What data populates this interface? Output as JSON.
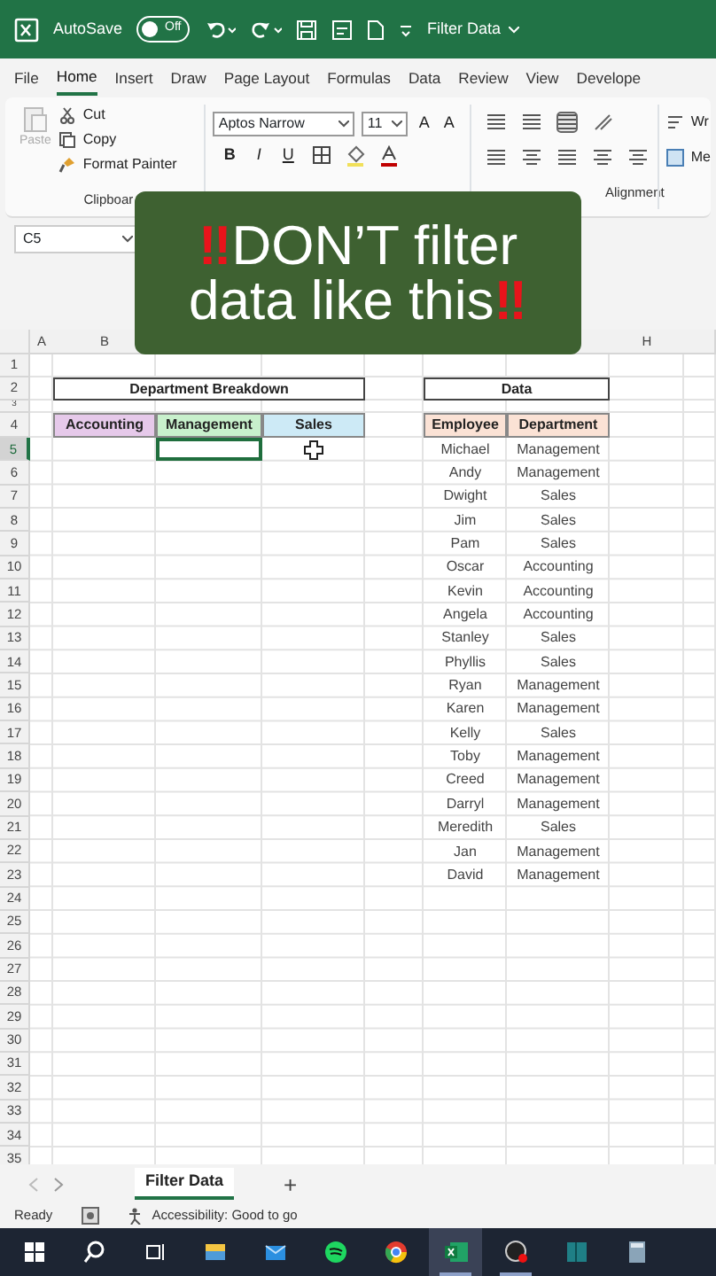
{
  "title_bar": {
    "autosave_label": "AutoSave",
    "autosave_state": "Off",
    "autosave_on": false,
    "file_title": "Filter Data"
  },
  "menu_tabs": [
    {
      "label": "File",
      "selected": false
    },
    {
      "label": "Home",
      "selected": true
    },
    {
      "label": "Insert",
      "selected": false
    },
    {
      "label": "Draw",
      "selected": false
    },
    {
      "label": "Page Layout",
      "selected": false
    },
    {
      "label": "Formulas",
      "selected": false
    },
    {
      "label": "Data",
      "selected": false
    },
    {
      "label": "Review",
      "selected": false
    },
    {
      "label": "View",
      "selected": false
    },
    {
      "label": "Develope",
      "selected": false
    }
  ],
  "ribbon": {
    "paste": "Paste",
    "cut": "Cut",
    "copy": "Copy",
    "format_painter": "Format Painter",
    "clipboard_group": "Clipboar",
    "font_name": "Aptos Narrow",
    "font_size": "11",
    "grow": "A",
    "shrink": "A",
    "bold": "B",
    "italic": "I",
    "underline": "U",
    "alignment_group": "Alignment",
    "wrap": "Wr",
    "merge": "Me"
  },
  "name_box": "C5",
  "caption": {
    "lines": [
      {
        "lead": "‼",
        "text": "DON’T filter"
      },
      {
        "text": "data like this",
        "trail": "‼"
      }
    ]
  },
  "sheet": {
    "column_headers": [
      "A",
      "B",
      "H"
    ],
    "row_headers": [
      {
        "label": "1",
        "selected": false
      },
      {
        "label": "2",
        "selected": false
      },
      {
        "label": "3",
        "selected": false
      },
      {
        "label": "4",
        "selected": false
      },
      {
        "label": "5",
        "selected": true
      },
      {
        "label": "6",
        "selected": false
      },
      {
        "label": "7",
        "selected": false
      },
      {
        "label": "8",
        "selected": false
      },
      {
        "label": "9",
        "selected": false
      },
      {
        "label": "10",
        "selected": false
      },
      {
        "label": "11",
        "selected": false
      },
      {
        "label": "12",
        "selected": false
      },
      {
        "label": "13",
        "selected": false
      },
      {
        "label": "14",
        "selected": false
      },
      {
        "label": "15",
        "selected": false
      },
      {
        "label": "16",
        "selected": false
      },
      {
        "label": "17",
        "selected": false
      },
      {
        "label": "18",
        "selected": false
      },
      {
        "label": "19",
        "selected": false
      },
      {
        "label": "20",
        "selected": false
      },
      {
        "label": "21",
        "selected": false
      },
      {
        "label": "22",
        "selected": false
      },
      {
        "label": "23",
        "selected": false
      },
      {
        "label": "24",
        "selected": false
      },
      {
        "label": "25",
        "selected": false
      },
      {
        "label": "26",
        "selected": false
      },
      {
        "label": "27",
        "selected": false
      },
      {
        "label": "28",
        "selected": false
      },
      {
        "label": "29",
        "selected": false
      },
      {
        "label": "30",
        "selected": false
      },
      {
        "label": "31",
        "selected": false
      },
      {
        "label": "32",
        "selected": false
      },
      {
        "label": "33",
        "selected": false
      },
      {
        "label": "34",
        "selected": false
      },
      {
        "label": "35",
        "selected": false
      }
    ],
    "breakdown": {
      "title": "Department Breakdown",
      "columns": [
        {
          "label": "Accounting",
          "color": "#e6c9ea",
          "selected": false
        },
        {
          "label": "Management",
          "color": "#c8f0cc",
          "selected": true
        },
        {
          "label": "Sales",
          "color": "#cdeaf6",
          "selected": false
        }
      ]
    },
    "data_table": {
      "title": "Data",
      "columns": [
        "Employee",
        "Department"
      ],
      "rows": [
        [
          "Michael",
          "Management"
        ],
        [
          "Andy",
          "Management"
        ],
        [
          "Dwight",
          "Sales"
        ],
        [
          "Jim",
          "Sales"
        ],
        [
          "Pam",
          "Sales"
        ],
        [
          "Oscar",
          "Accounting"
        ],
        [
          "Kevin",
          "Accounting"
        ],
        [
          "Angela",
          "Accounting"
        ],
        [
          "Stanley",
          "Sales"
        ],
        [
          "Phyllis",
          "Sales"
        ],
        [
          "Ryan",
          "Management"
        ],
        [
          "Karen",
          "Management"
        ],
        [
          "Kelly",
          "Sales"
        ],
        [
          "Toby",
          "Management"
        ],
        [
          "Creed",
          "Management"
        ],
        [
          "Darryl",
          "Management"
        ],
        [
          "Meredith",
          "Sales"
        ],
        [
          "Jan",
          "Management"
        ],
        [
          "David",
          "Management"
        ]
      ]
    }
  },
  "sheet_tabs": [
    {
      "label": "Filter Data",
      "selected": true
    }
  ],
  "add_sheet": "+",
  "status_bar": {
    "mode": "Ready",
    "accessibility": "Accessibility: Good to go"
  },
  "taskbar": [
    {
      "kind": "start",
      "selected": false,
      "running": false
    },
    {
      "kind": "search",
      "selected": false,
      "running": false
    },
    {
      "kind": "taskview",
      "selected": false,
      "running": false
    },
    {
      "kind": "folder",
      "selected": false,
      "running": false
    },
    {
      "kind": "mail",
      "selected": false,
      "running": false
    },
    {
      "kind": "music",
      "selected": false,
      "running": false
    },
    {
      "kind": "browser",
      "selected": false,
      "running": false
    },
    {
      "kind": "spreadsheet",
      "selected": true,
      "running": true
    },
    {
      "kind": "recorder",
      "selected": false,
      "running": true
    },
    {
      "kind": "panel",
      "selected": false,
      "running": false
    },
    {
      "kind": "calculator",
      "selected": false,
      "running": false
    }
  ]
}
